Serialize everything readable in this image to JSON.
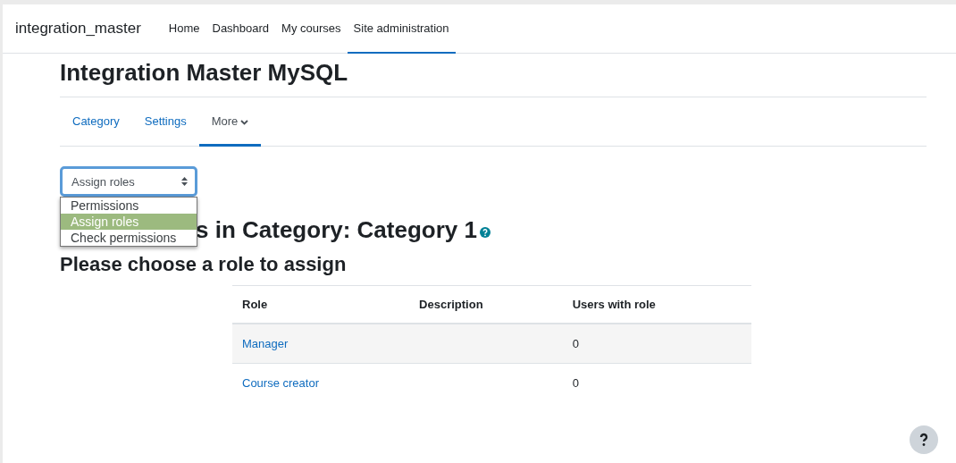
{
  "site_name": "integration_master",
  "nav": [
    {
      "label": "Home",
      "selected": false
    },
    {
      "label": "Dashboard",
      "selected": false
    },
    {
      "label": "My courses",
      "selected": false
    },
    {
      "label": "Site administration",
      "selected": true
    }
  ],
  "page_title": "Integration Master MySQL",
  "secondary_nav": [
    {
      "label": "Category",
      "selected": false,
      "kind": "link"
    },
    {
      "label": "Settings",
      "selected": false,
      "kind": "link"
    },
    {
      "label": "More",
      "selected": true,
      "kind": "dropdown"
    }
  ],
  "select": {
    "value": "Assign roles",
    "expanded": true,
    "options": [
      {
        "label": "Permissions",
        "selected": false
      },
      {
        "label": "Assign roles",
        "selected": true
      },
      {
        "label": "Check permissions",
        "selected": false
      }
    ]
  },
  "heading": "s in Category: Category 1",
  "subheading": "Please choose a role to assign",
  "table": {
    "columns": [
      "Role",
      "Description",
      "Users with role"
    ],
    "rows": [
      {
        "role": "Manager",
        "users": "0"
      },
      {
        "role": "Course creator",
        "users": "0"
      }
    ]
  }
}
